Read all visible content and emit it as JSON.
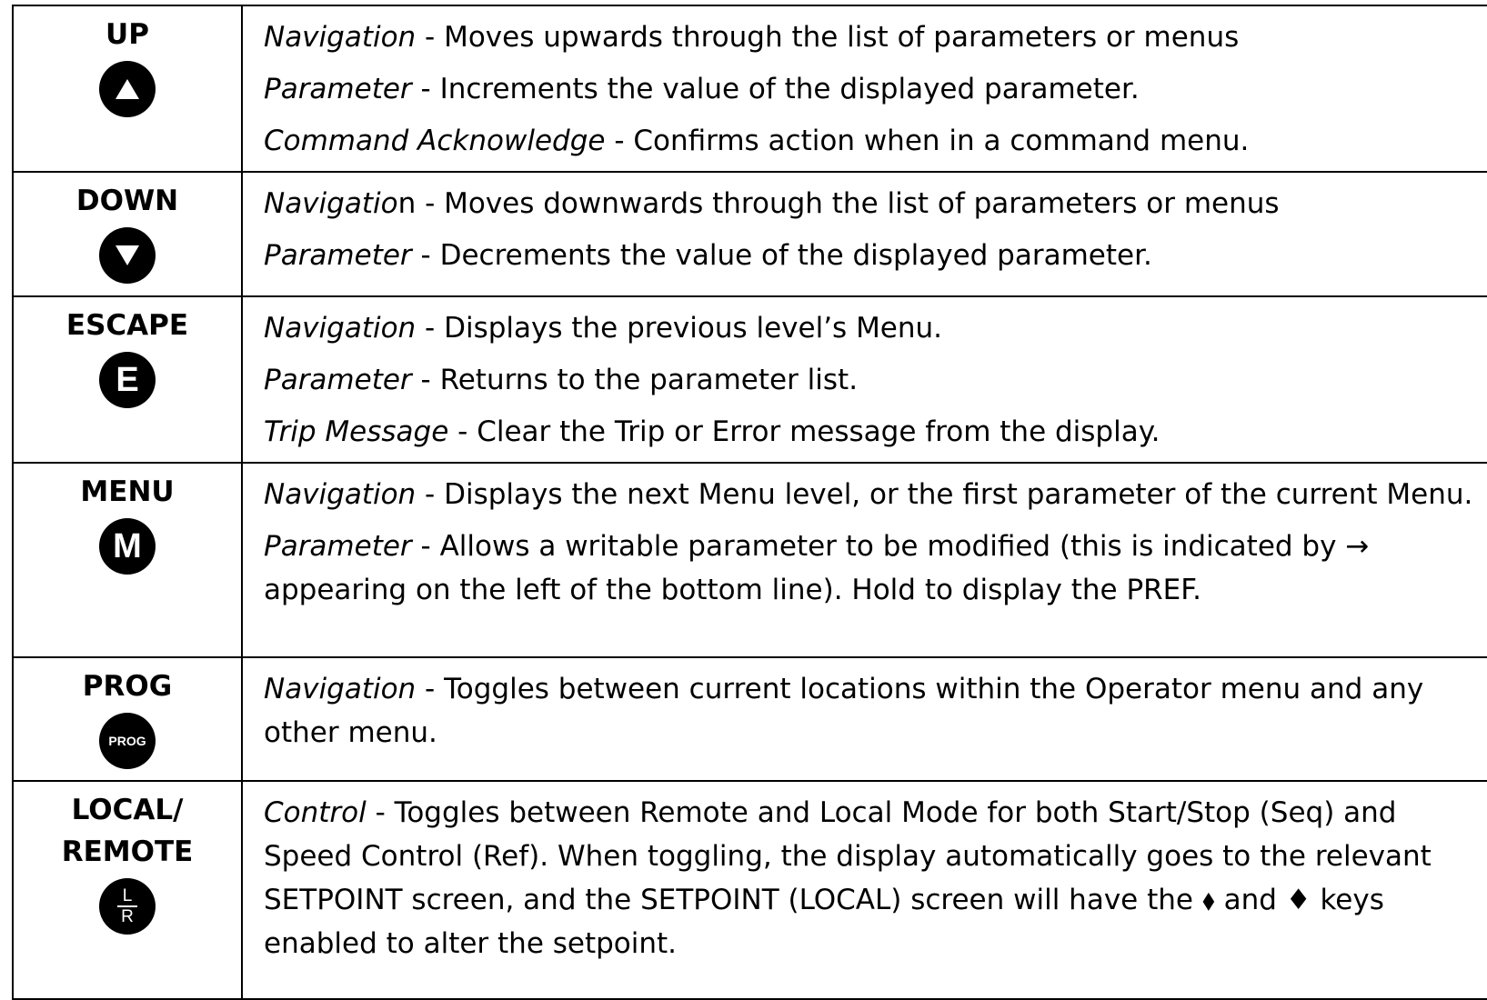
{
  "rows": [
    {
      "key": "UP",
      "icon": "up-triangle-icon",
      "desc": [
        {
          "term": "Navigation",
          "text": " - Moves upwards through the list of parameters or menus"
        },
        {
          "term": "Parameter",
          "text": " - Increments the value of the displayed parameter."
        },
        {
          "term": "Command Acknowledge",
          "text": " - Confirms action when in a command menu."
        }
      ]
    },
    {
      "key": "DOWN",
      "icon": "down-triangle-icon",
      "desc": [
        {
          "term": "Navigatio",
          "text": "n - Moves downwards through the list of parameters or menus"
        },
        {
          "term": "Parameter",
          "text": " - Decrements the value of the displayed parameter."
        }
      ]
    },
    {
      "key": "ESCAPE",
      "icon": "escape-e-icon",
      "icon_text": "E",
      "desc": [
        {
          "term": "Navigation",
          "text": " - Displays the previous level’s Menu."
        },
        {
          "term": "Parameter",
          "text": " - Returns to the parameter list."
        },
        {
          "term": "Trip Message",
          "text": " - Clear the Trip or Error message from the display."
        }
      ]
    },
    {
      "key": "MENU",
      "icon": "menu-m-icon",
      "icon_text": "M",
      "desc": [
        {
          "term": "Navigation",
          "text": " - Displays the next Menu level, or the first parameter of the current Menu."
        },
        {
          "term": "Parameter",
          "text": " - Allows a writable parameter to be modified (this is indicated by → appearing on the left of the bottom line). Hold to display the PREF."
        }
      ]
    },
    {
      "key": "PROG",
      "icon": "prog-icon",
      "icon_text": "PROG",
      "desc": [
        {
          "term": "Navigation",
          "text": " - Toggles between current locations within the Operator menu and any other menu."
        }
      ]
    },
    {
      "key": "LOCAL/\nREMOTE",
      "icon": "local-remote-lr-icon",
      "icon_top": "L",
      "icon_bottom": "R",
      "desc": [
        {
          "term": "Control",
          "text": " - Toggles between Remote and Local Mode for both Start/Stop (Seq) and Speed Control (Ref). When toggling, the display automatically goes to the relevant SETPOINT screen, and the SETPOINT (LOCAL) screen will have the ⬧ and ♦ keys enabled to alter the setpoint."
        }
      ]
    }
  ]
}
